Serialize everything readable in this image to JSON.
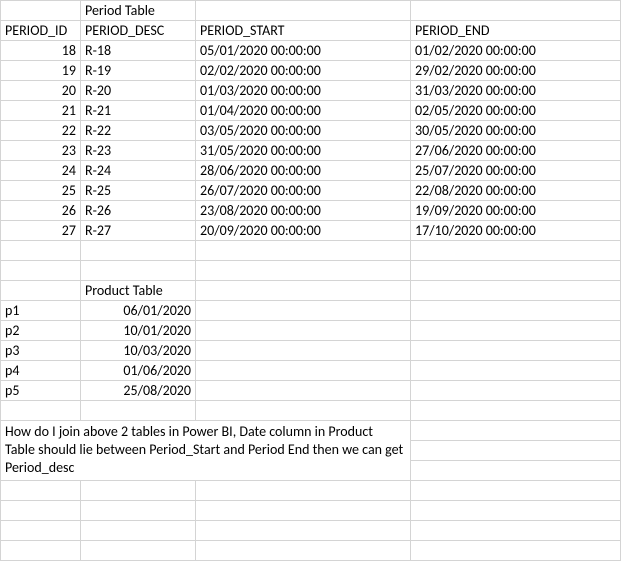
{
  "period_table": {
    "title": "Period Table",
    "headers": {
      "id": "PERIOD_ID",
      "desc": "PERIOD_DESC",
      "start": "PERIOD_START",
      "end": "PERIOD_END"
    },
    "rows": [
      {
        "id": "18",
        "desc": "R-18",
        "start": "05/01/2020 00:00:00",
        "end": "01/02/2020 00:00:00"
      },
      {
        "id": "19",
        "desc": "R-19",
        "start": "02/02/2020 00:00:00",
        "end": "29/02/2020 00:00:00"
      },
      {
        "id": "20",
        "desc": "R-20",
        "start": "01/03/2020 00:00:00",
        "end": "31/03/2020 00:00:00"
      },
      {
        "id": "21",
        "desc": "R-21",
        "start": "01/04/2020 00:00:00",
        "end": "02/05/2020 00:00:00"
      },
      {
        "id": "22",
        "desc": "R-22",
        "start": "03/05/2020 00:00:00",
        "end": "30/05/2020 00:00:00"
      },
      {
        "id": "23",
        "desc": "R-23",
        "start": "31/05/2020 00:00:00",
        "end": "27/06/2020 00:00:00"
      },
      {
        "id": "24",
        "desc": "R-24",
        "start": "28/06/2020 00:00:00",
        "end": "25/07/2020 00:00:00"
      },
      {
        "id": "25",
        "desc": "R-25",
        "start": "26/07/2020 00:00:00",
        "end": "22/08/2020 00:00:00"
      },
      {
        "id": "26",
        "desc": "R-26",
        "start": "23/08/2020 00:00:00",
        "end": "19/09/2020 00:00:00"
      },
      {
        "id": "27",
        "desc": "R-27",
        "start": "20/09/2020 00:00:00",
        "end": "17/10/2020 00:00:00"
      }
    ]
  },
  "product_table": {
    "title": "Product Table",
    "rows": [
      {
        "p": "p1",
        "date": "06/01/2020"
      },
      {
        "p": "p2",
        "date": "10/01/2020"
      },
      {
        "p": "p3",
        "date": "10/03/2020"
      },
      {
        "p": "p4",
        "date": "01/06/2020"
      },
      {
        "p": "p5",
        "date": "25/08/2020"
      }
    ]
  },
  "question": "How do I join above 2 tables in Power BI, Date column in Product Table should lie between Period_Start and Period End then we can get Period_desc"
}
